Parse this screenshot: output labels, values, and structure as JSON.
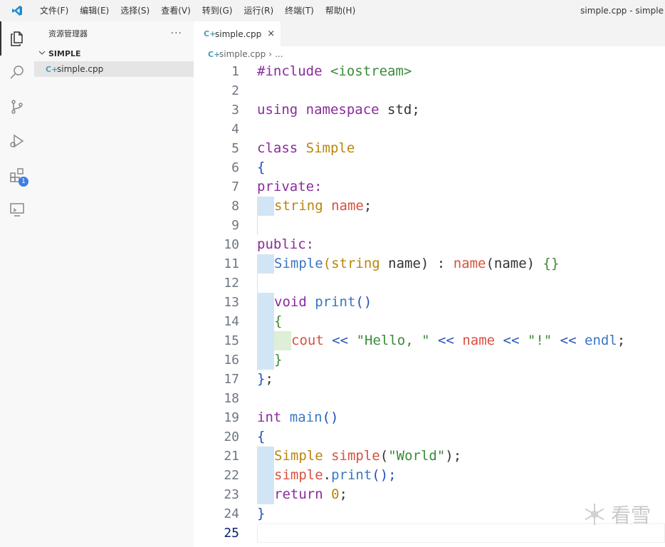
{
  "menu": [
    "文件(F)",
    "编辑(E)",
    "选择(S)",
    "查看(V)",
    "转到(G)",
    "运行(R)",
    "终端(T)",
    "帮助(H)"
  ],
  "window_title": "simple.cpp - simple",
  "activity": {
    "extensions_badge": "1"
  },
  "sidebar": {
    "title": "资源管理器",
    "more": "···",
    "folder": "SIMPLE",
    "file": "simple.cpp"
  },
  "tab": {
    "label": "simple.cpp",
    "close": "×"
  },
  "breadcrumb": {
    "file": "simple.cpp",
    "rest": "..."
  },
  "line_numbers": [
    "1",
    "2",
    "3",
    "4",
    "5",
    "6",
    "7",
    "8",
    "9",
    "10",
    "11",
    "12",
    "13",
    "14",
    "15",
    "16",
    "17",
    "18",
    "19",
    "20",
    "21",
    "22",
    "23",
    "24",
    "25"
  ],
  "code": {
    "l1": [
      "#include",
      " ",
      "<iostream>"
    ],
    "l3": [
      "using",
      " ",
      "namespace",
      " std;"
    ],
    "l5": [
      "class",
      " ",
      "Simple"
    ],
    "l6": [
      "{"
    ],
    "l7": [
      "private:"
    ],
    "l8": [
      "string",
      " ",
      "name",
      ";"
    ],
    "l10": [
      "public:"
    ],
    "l11": [
      "Simple",
      "(",
      "string",
      " name) : ",
      "name",
      "(name) ",
      "{}"
    ],
    "l13": [
      "void",
      " ",
      "print",
      "()"
    ],
    "l14": [
      "{"
    ],
    "l15": [
      "cout",
      " ",
      "<<",
      " ",
      "\"Hello, \"",
      " ",
      "<<",
      " ",
      "name",
      " ",
      "<<",
      " ",
      "\"!\"",
      " ",
      "<<",
      " ",
      "endl",
      ";"
    ],
    "l16": [
      "}"
    ],
    "l17": [
      "}",
      ";"
    ],
    "l19": [
      "int",
      " ",
      "main",
      "()"
    ],
    "l20": [
      "{"
    ],
    "l21": [
      "Simple",
      " ",
      "simple",
      "(",
      "\"World\"",
      ");"
    ],
    "l22": [
      "simple",
      ".",
      "print",
      "();"
    ],
    "l23": [
      "return",
      " ",
      "0",
      ";"
    ],
    "l24": [
      "}"
    ]
  },
  "watermark": "看雪"
}
